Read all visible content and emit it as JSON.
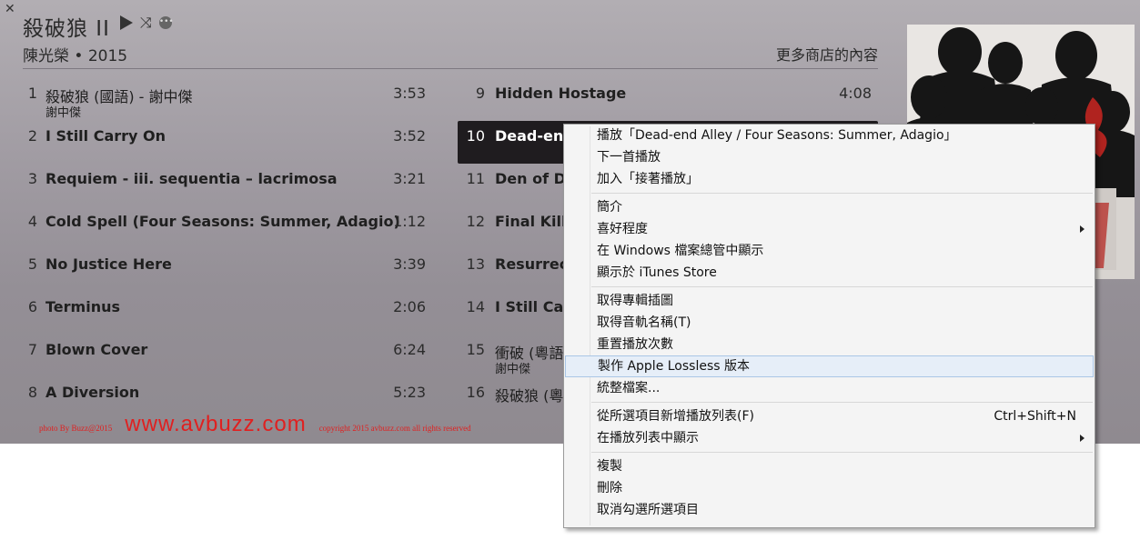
{
  "header": {
    "close_symbol": "✕",
    "album_title": "殺破狼 II",
    "album_subtitle": "陳光榮 • 2015",
    "store_link": "更多商店的內容",
    "shuffle_symbol": "⤨",
    "more_symbol": "•••"
  },
  "tracks_left": [
    {
      "num": "1",
      "title": "殺破狼 (國語) - 謝中傑",
      "artist": "謝中傑",
      "duration": "3:53"
    },
    {
      "num": "2",
      "title": "I Still Carry On",
      "artist": "",
      "duration": "3:52"
    },
    {
      "num": "3",
      "title": "Requiem - iii. sequentia – lacrimosa",
      "artist": "",
      "duration": "3:21"
    },
    {
      "num": "4",
      "title": "Cold Spell (Four Seasons: Summer, Adagio)",
      "artist": "",
      "duration": "1:12"
    },
    {
      "num": "5",
      "title": "No Justice Here",
      "artist": "",
      "duration": "3:39"
    },
    {
      "num": "6",
      "title": "Terminus",
      "artist": "",
      "duration": "2:06"
    },
    {
      "num": "7",
      "title": "Blown Cover",
      "artist": "",
      "duration": "6:24"
    },
    {
      "num": "8",
      "title": "A Diversion",
      "artist": "",
      "duration": "5:23"
    }
  ],
  "tracks_right": [
    {
      "num": "9",
      "title": "Hidden Hostage",
      "artist": "",
      "duration": "4:08"
    },
    {
      "num": "10",
      "title": "Dead-end",
      "artist": "",
      "duration": ""
    },
    {
      "num": "11",
      "title": "Den of De",
      "artist": "",
      "duration": ""
    },
    {
      "num": "12",
      "title": "Final Killin",
      "artist": "",
      "duration": ""
    },
    {
      "num": "13",
      "title": "Resurrecti",
      "artist": "",
      "duration": ""
    },
    {
      "num": "14",
      "title": "I Still Carr",
      "artist": "",
      "duration": ""
    },
    {
      "num": "15",
      "title": "衝破 (粵語",
      "artist": "謝中傑",
      "duration": ""
    },
    {
      "num": "16",
      "title": "殺破狼 (粵",
      "artist": "",
      "duration": ""
    }
  ],
  "watermark": {
    "left_text": "photo By Buzz@2015",
    "site": "www.avbuzz.com",
    "right_text": "copyright 2015 avbuzz.com all rights reserved"
  },
  "context_menu": {
    "groups": [
      [
        {
          "label": "播放「Dead-end Alley / Four Seasons: Summer, Adagio」"
        },
        {
          "label": "下一首播放"
        },
        {
          "label": "加入「接著播放」"
        }
      ],
      [
        {
          "label": "簡介"
        },
        {
          "label": "喜好程度",
          "submenu": true
        },
        {
          "label": "在 Windows 檔案總管中顯示"
        },
        {
          "label": "顯示於 iTunes Store"
        }
      ],
      [
        {
          "label": "取得專輯插圖"
        },
        {
          "label": "取得音軌名稱(T)"
        },
        {
          "label": "重置播放次數"
        },
        {
          "label": "製作 Apple Lossless 版本",
          "hover": true
        },
        {
          "label": "統整檔案..."
        }
      ],
      [
        {
          "label": "從所選項目新增播放列表(F)",
          "shortcut": "Ctrl+Shift+N"
        },
        {
          "label": "在播放列表中顯示",
          "submenu": true
        }
      ],
      [
        {
          "label": "複製"
        },
        {
          "label": "刪除"
        },
        {
          "label": "取消勾選所選項目"
        }
      ]
    ]
  },
  "colors": {
    "watermark": "#e02020",
    "selected_row": "#1f1c1f",
    "menu_hover": "#e6eef8"
  }
}
